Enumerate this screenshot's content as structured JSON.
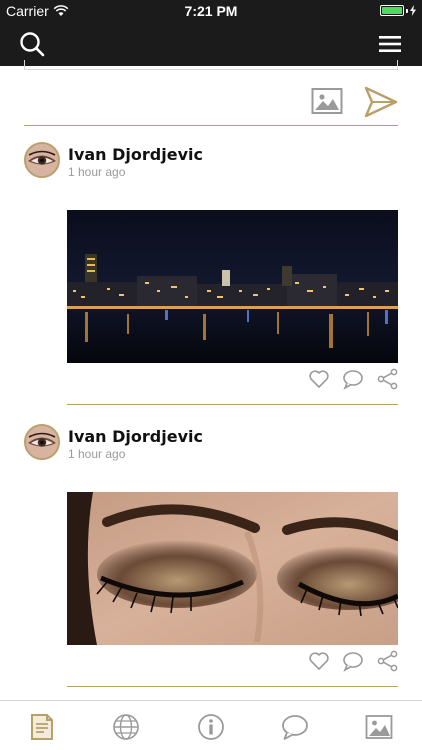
{
  "status_bar": {
    "carrier": "Carrier",
    "time": "7:21 PM"
  },
  "nav": {
    "search_icon": "search-icon",
    "menu_icon": "hamburger-menu-icon"
  },
  "composer": {
    "image_icon": "image-icon",
    "send_icon": "send-icon"
  },
  "posts": [
    {
      "author": "Ivan Djordjevic",
      "time": "1 hour ago",
      "image": "city-night-skyline"
    },
    {
      "author": "Ivan Djordjevic",
      "time": "1 hour ago",
      "image": "smoky-eye-makeup"
    }
  ],
  "tab_bar": {
    "tabs": [
      "feed-icon",
      "globe-icon",
      "info-icon",
      "chat-icon",
      "gallery-icon"
    ],
    "active": "feed-icon"
  },
  "colors": {
    "accent": "#b8a06a",
    "nav_background": "#1b1b1b",
    "icon_gray": "#9a9a9a"
  }
}
